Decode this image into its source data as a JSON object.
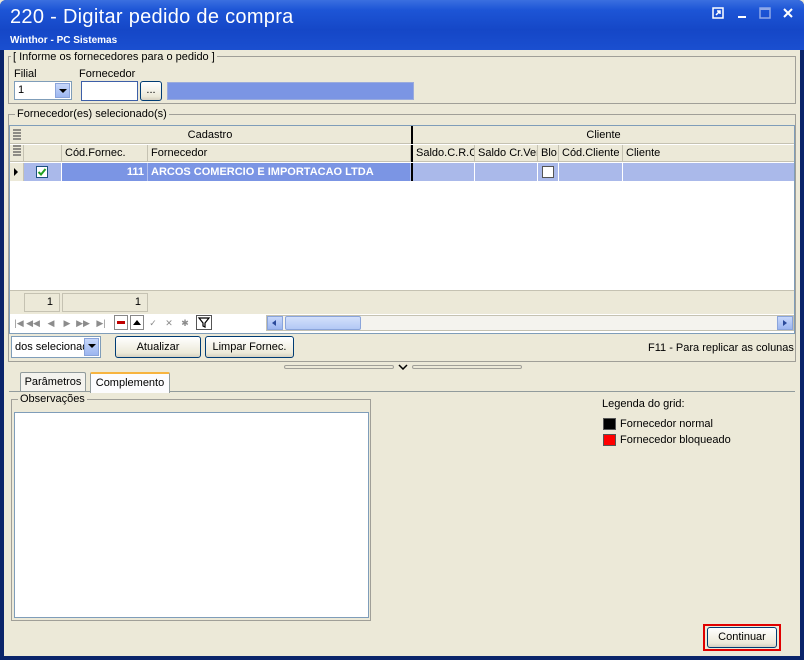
{
  "window": {
    "title": "220 - Digitar pedido de compra",
    "subtitle": "Winthor - PC Sistemas"
  },
  "fornecedores_group": {
    "caption": "[ Informe os fornecedores para o pedido ]",
    "filial_label": "Filial",
    "filial_value": "1",
    "fornecedor_label": "Fornecedor",
    "fornecedor_value": "",
    "browse_label": "...",
    "fornecedor_name_value": ""
  },
  "selected_group": {
    "caption": "Fornecedor(es) selecionado(s)"
  },
  "grid": {
    "bands": [
      "Cadastro",
      "Cliente"
    ],
    "columns": [
      "Cód.Fornec.",
      "Fornecedor",
      "Saldo.C.R.C",
      "Saldo Cr.Ven",
      "Blo",
      "Cód.Cliente",
      "Cliente"
    ],
    "rows": [
      {
        "checked": true,
        "cod_fornec": "111",
        "fornecedor": "ARCOS COMERCIO E IMPORTACAO LTDA",
        "saldo_crc": "",
        "saldo_crven": "",
        "bloqueado": false,
        "cod_cliente": "",
        "cliente": ""
      }
    ],
    "footer_count_left": "1",
    "footer_count_right": "1"
  },
  "actions": {
    "select_combo_value": "dos selecionad",
    "atualizar_label": "Atualizar",
    "limpar_label": "Limpar Fornec.",
    "hint": "F11 - Para replicar as colunas"
  },
  "tabs": [
    {
      "label": "Parâmetros",
      "active": false
    },
    {
      "label": "Complemento",
      "active": true
    }
  ],
  "complemento": {
    "observacoes_caption": "Observações",
    "observacoes_value": "",
    "legend_title": "Legenda do grid:",
    "legend_items": [
      {
        "label": "Fornecedor normal",
        "color": "#000000"
      },
      {
        "label": "Fornecedor bloqueado",
        "color": "#ff0000"
      }
    ]
  },
  "continue_label": "Continuar",
  "colors": {
    "titlebar": "#1547c7",
    "selected_row": "#7b95e4",
    "highlight": "#e00000"
  }
}
